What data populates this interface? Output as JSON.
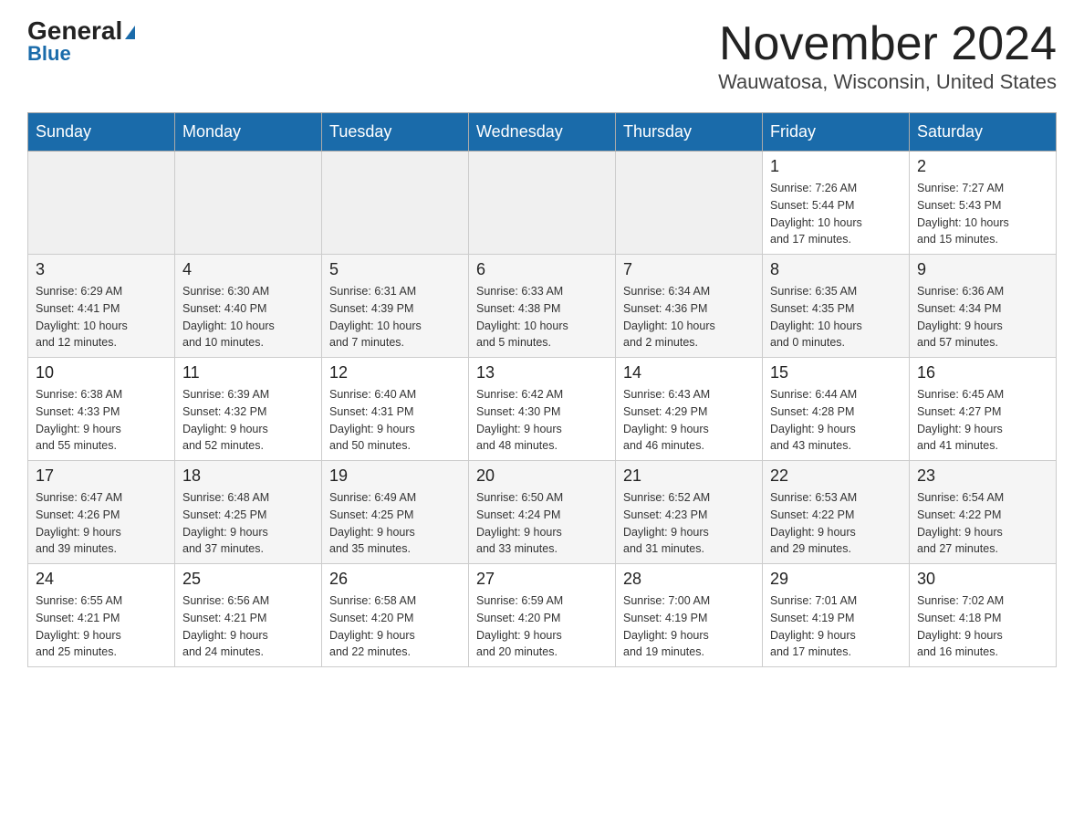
{
  "header": {
    "logo_general": "General",
    "logo_blue": "Blue",
    "month_title": "November 2024",
    "location": "Wauwatosa, Wisconsin, United States"
  },
  "calendar": {
    "days_of_week": [
      "Sunday",
      "Monday",
      "Tuesday",
      "Wednesday",
      "Thursday",
      "Friday",
      "Saturday"
    ],
    "weeks": [
      [
        {
          "day": "",
          "info": ""
        },
        {
          "day": "",
          "info": ""
        },
        {
          "day": "",
          "info": ""
        },
        {
          "day": "",
          "info": ""
        },
        {
          "day": "",
          "info": ""
        },
        {
          "day": "1",
          "info": "Sunrise: 7:26 AM\nSunset: 5:44 PM\nDaylight: 10 hours\nand 17 minutes."
        },
        {
          "day": "2",
          "info": "Sunrise: 7:27 AM\nSunset: 5:43 PM\nDaylight: 10 hours\nand 15 minutes."
        }
      ],
      [
        {
          "day": "3",
          "info": "Sunrise: 6:29 AM\nSunset: 4:41 PM\nDaylight: 10 hours\nand 12 minutes."
        },
        {
          "day": "4",
          "info": "Sunrise: 6:30 AM\nSunset: 4:40 PM\nDaylight: 10 hours\nand 10 minutes."
        },
        {
          "day": "5",
          "info": "Sunrise: 6:31 AM\nSunset: 4:39 PM\nDaylight: 10 hours\nand 7 minutes."
        },
        {
          "day": "6",
          "info": "Sunrise: 6:33 AM\nSunset: 4:38 PM\nDaylight: 10 hours\nand 5 minutes."
        },
        {
          "day": "7",
          "info": "Sunrise: 6:34 AM\nSunset: 4:36 PM\nDaylight: 10 hours\nand 2 minutes."
        },
        {
          "day": "8",
          "info": "Sunrise: 6:35 AM\nSunset: 4:35 PM\nDaylight: 10 hours\nand 0 minutes."
        },
        {
          "day": "9",
          "info": "Sunrise: 6:36 AM\nSunset: 4:34 PM\nDaylight: 9 hours\nand 57 minutes."
        }
      ],
      [
        {
          "day": "10",
          "info": "Sunrise: 6:38 AM\nSunset: 4:33 PM\nDaylight: 9 hours\nand 55 minutes."
        },
        {
          "day": "11",
          "info": "Sunrise: 6:39 AM\nSunset: 4:32 PM\nDaylight: 9 hours\nand 52 minutes."
        },
        {
          "day": "12",
          "info": "Sunrise: 6:40 AM\nSunset: 4:31 PM\nDaylight: 9 hours\nand 50 minutes."
        },
        {
          "day": "13",
          "info": "Sunrise: 6:42 AM\nSunset: 4:30 PM\nDaylight: 9 hours\nand 48 minutes."
        },
        {
          "day": "14",
          "info": "Sunrise: 6:43 AM\nSunset: 4:29 PM\nDaylight: 9 hours\nand 46 minutes."
        },
        {
          "day": "15",
          "info": "Sunrise: 6:44 AM\nSunset: 4:28 PM\nDaylight: 9 hours\nand 43 minutes."
        },
        {
          "day": "16",
          "info": "Sunrise: 6:45 AM\nSunset: 4:27 PM\nDaylight: 9 hours\nand 41 minutes."
        }
      ],
      [
        {
          "day": "17",
          "info": "Sunrise: 6:47 AM\nSunset: 4:26 PM\nDaylight: 9 hours\nand 39 minutes."
        },
        {
          "day": "18",
          "info": "Sunrise: 6:48 AM\nSunset: 4:25 PM\nDaylight: 9 hours\nand 37 minutes."
        },
        {
          "day": "19",
          "info": "Sunrise: 6:49 AM\nSunset: 4:25 PM\nDaylight: 9 hours\nand 35 minutes."
        },
        {
          "day": "20",
          "info": "Sunrise: 6:50 AM\nSunset: 4:24 PM\nDaylight: 9 hours\nand 33 minutes."
        },
        {
          "day": "21",
          "info": "Sunrise: 6:52 AM\nSunset: 4:23 PM\nDaylight: 9 hours\nand 31 minutes."
        },
        {
          "day": "22",
          "info": "Sunrise: 6:53 AM\nSunset: 4:22 PM\nDaylight: 9 hours\nand 29 minutes."
        },
        {
          "day": "23",
          "info": "Sunrise: 6:54 AM\nSunset: 4:22 PM\nDaylight: 9 hours\nand 27 minutes."
        }
      ],
      [
        {
          "day": "24",
          "info": "Sunrise: 6:55 AM\nSunset: 4:21 PM\nDaylight: 9 hours\nand 25 minutes."
        },
        {
          "day": "25",
          "info": "Sunrise: 6:56 AM\nSunset: 4:21 PM\nDaylight: 9 hours\nand 24 minutes."
        },
        {
          "day": "26",
          "info": "Sunrise: 6:58 AM\nSunset: 4:20 PM\nDaylight: 9 hours\nand 22 minutes."
        },
        {
          "day": "27",
          "info": "Sunrise: 6:59 AM\nSunset: 4:20 PM\nDaylight: 9 hours\nand 20 minutes."
        },
        {
          "day": "28",
          "info": "Sunrise: 7:00 AM\nSunset: 4:19 PM\nDaylight: 9 hours\nand 19 minutes."
        },
        {
          "day": "29",
          "info": "Sunrise: 7:01 AM\nSunset: 4:19 PM\nDaylight: 9 hours\nand 17 minutes."
        },
        {
          "day": "30",
          "info": "Sunrise: 7:02 AM\nSunset: 4:18 PM\nDaylight: 9 hours\nand 16 minutes."
        }
      ]
    ]
  }
}
